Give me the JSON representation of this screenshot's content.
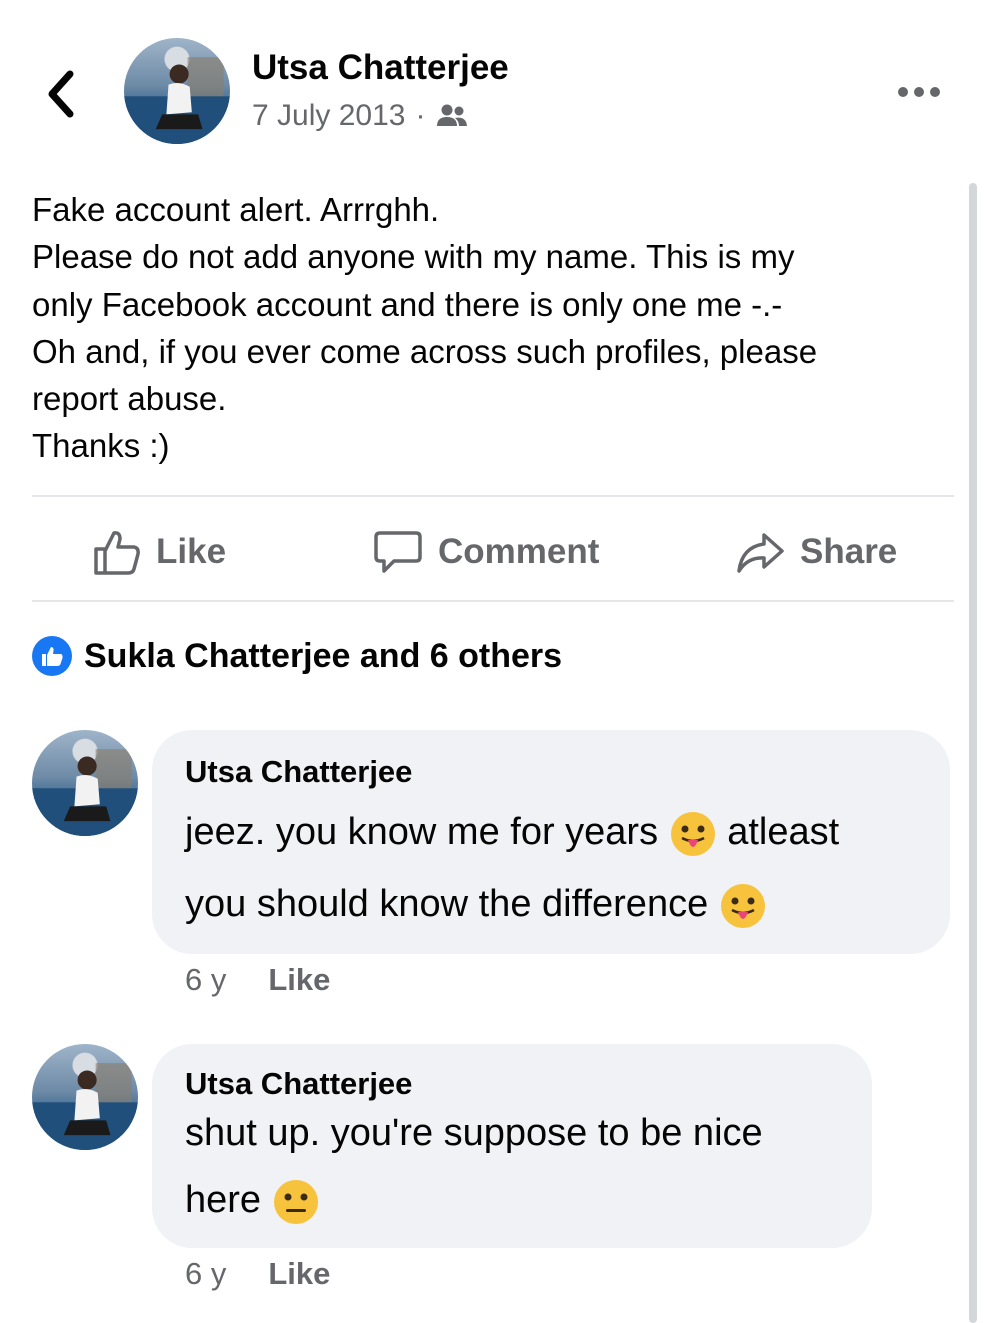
{
  "header": {
    "author": "Utsa Chatterjee",
    "date": "7 July 2013",
    "separator": "·",
    "audience_icon": "friends-icon",
    "more_icon": "more-dots-icon",
    "back_icon": "chevron-left-icon"
  },
  "post": {
    "lines": [
      "Fake account alert. Arrrghh.",
      "Please do not add anyone with my name. This is my",
      "only Facebook account and there is only one me -.-",
      "Oh and, if you ever come across such profiles, please",
      "report abuse.",
      "Thanks :)"
    ]
  },
  "actions": {
    "like": "Like",
    "comment": "Comment",
    "share": "Share"
  },
  "reactions": {
    "summary": "Sukla Chatterjee and 6 others",
    "accent": "#1877f2"
  },
  "comments": [
    {
      "author": "Utsa Chatterjee",
      "line1": "jeez. you know me for years",
      "line1_end": "atleast",
      "line2": "you should know the difference",
      "emoji": "tongue-out-emoji-icon",
      "time": "6 y",
      "like": "Like"
    },
    {
      "author": "Utsa Chatterjee",
      "line1": "shut up. you're suppose to be nice",
      "line2": "here",
      "emoji": "neutral-face-emoji-icon",
      "time": "6 y",
      "like": "Like"
    }
  ],
  "colors": {
    "primary_text": "#050505",
    "secondary_text": "#65676b",
    "bubble": "#f0f2f5",
    "divider": "#e4e6eb"
  }
}
